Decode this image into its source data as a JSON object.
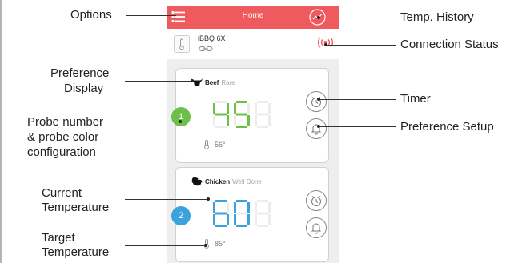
{
  "app": {
    "title": "Home",
    "device_name": "iBBQ 6X",
    "accent_color": "#ef5a5f"
  },
  "probes": [
    {
      "number": "1",
      "color": "#6cc04a",
      "preference_meat": "Beef",
      "preference_level": "Rare",
      "current_temp": "45",
      "target_temp": "56°",
      "icon": "beef-icon"
    },
    {
      "number": "2",
      "color": "#3ba2dd",
      "preference_meat": "Chicken",
      "preference_level": "Well Done",
      "current_temp": "60",
      "target_temp": "85°",
      "icon": "chicken-icon"
    }
  ],
  "annotations": {
    "options": "Options",
    "temp_history": "Temp. History",
    "connection_status": "Connection Status",
    "preference_display_1": "Preference",
    "preference_display_2": "Display",
    "timer": "Timer",
    "preference_setup": "Preference Setup",
    "probe_number_1": "Probe number",
    "probe_number_2": "& probe color",
    "probe_number_3": "configuration",
    "current_temperature_1": "Current",
    "current_temperature_2": "Temperature",
    "target_temperature_1": "Target",
    "target_temperature_2": "Temperature"
  },
  "icons": {
    "menu": "options-menu-icon",
    "history": "temp-history-icon",
    "connection": "connection-status-icon",
    "timer": "timer-icon",
    "bell": "preference-setup-bell-icon",
    "thermometer": "thermometer-icon"
  }
}
